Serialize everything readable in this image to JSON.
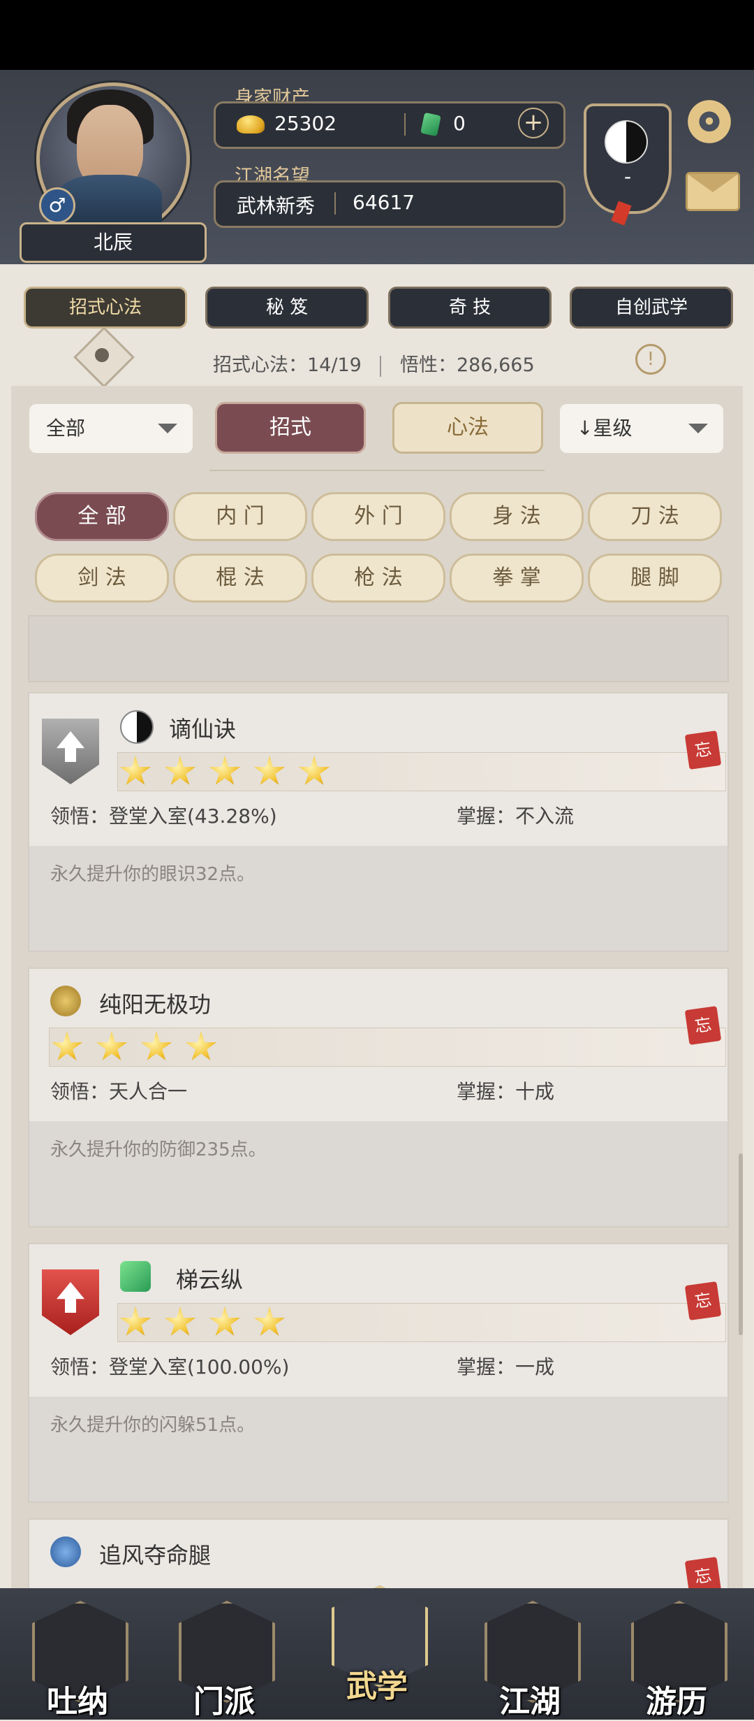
{
  "header": {
    "player_name": "北辰",
    "gender_symbol": "♂",
    "wealth_label": "身家财产",
    "gold_amount": "25302",
    "jade_amount": "0",
    "plus_symbol": "+",
    "reputation_label": "江湖名望",
    "reputation_title": "武林新秀",
    "reputation_value": "64617",
    "sect_badge_text": "-"
  },
  "top_tabs": [
    {
      "label": "招式心法"
    },
    {
      "label": "秘 笈"
    },
    {
      "label": "奇 技"
    },
    {
      "label": "自创武学"
    }
  ],
  "stats": {
    "moves_label": "招式心法：14/19",
    "insight_label": "悟性：286,665"
  },
  "filters": {
    "category_dropdown": "全部",
    "seg_moves": "招式",
    "seg_heart": "心法",
    "sort_dropdown": "↓星级",
    "chips_row1": [
      "全 部",
      "内 门",
      "外 门",
      "身 法",
      "刀 法"
    ],
    "chips_row2": [
      "剑 法",
      "棍 法",
      "枪 法",
      "拳 掌",
      "腿 脚"
    ]
  },
  "skills": [
    {
      "name": "谪仙诀",
      "stars": 5,
      "comprehension": "领悟：登堂入室(43.28%)",
      "mastery": "掌握：不入流",
      "description": "永久提升你的眼识32点。",
      "forget_label": "忘"
    },
    {
      "name": "纯阳无极功",
      "stars": 4,
      "comprehension": "领悟：天人合一",
      "mastery": "掌握：十成",
      "description": "永久提升你的防御235点。",
      "forget_label": "忘"
    },
    {
      "name": "梯云纵",
      "stars": 4,
      "comprehension": "领悟：登堂入室(100.00%)",
      "mastery": "掌握：一成",
      "description": "永久提升你的闪躲51点。",
      "forget_label": "忘"
    },
    {
      "name": "追风夺命腿",
      "forget_label": "忘"
    }
  ],
  "bottom_nav": [
    {
      "label": "吐纳"
    },
    {
      "label": "门派"
    },
    {
      "label": "武学"
    },
    {
      "label": "江湖"
    },
    {
      "label": "游历"
    }
  ],
  "colors": {
    "accent_active": "#7a4c52",
    "gold_text": "#e2c89a",
    "forget_red": "#c83a35"
  }
}
